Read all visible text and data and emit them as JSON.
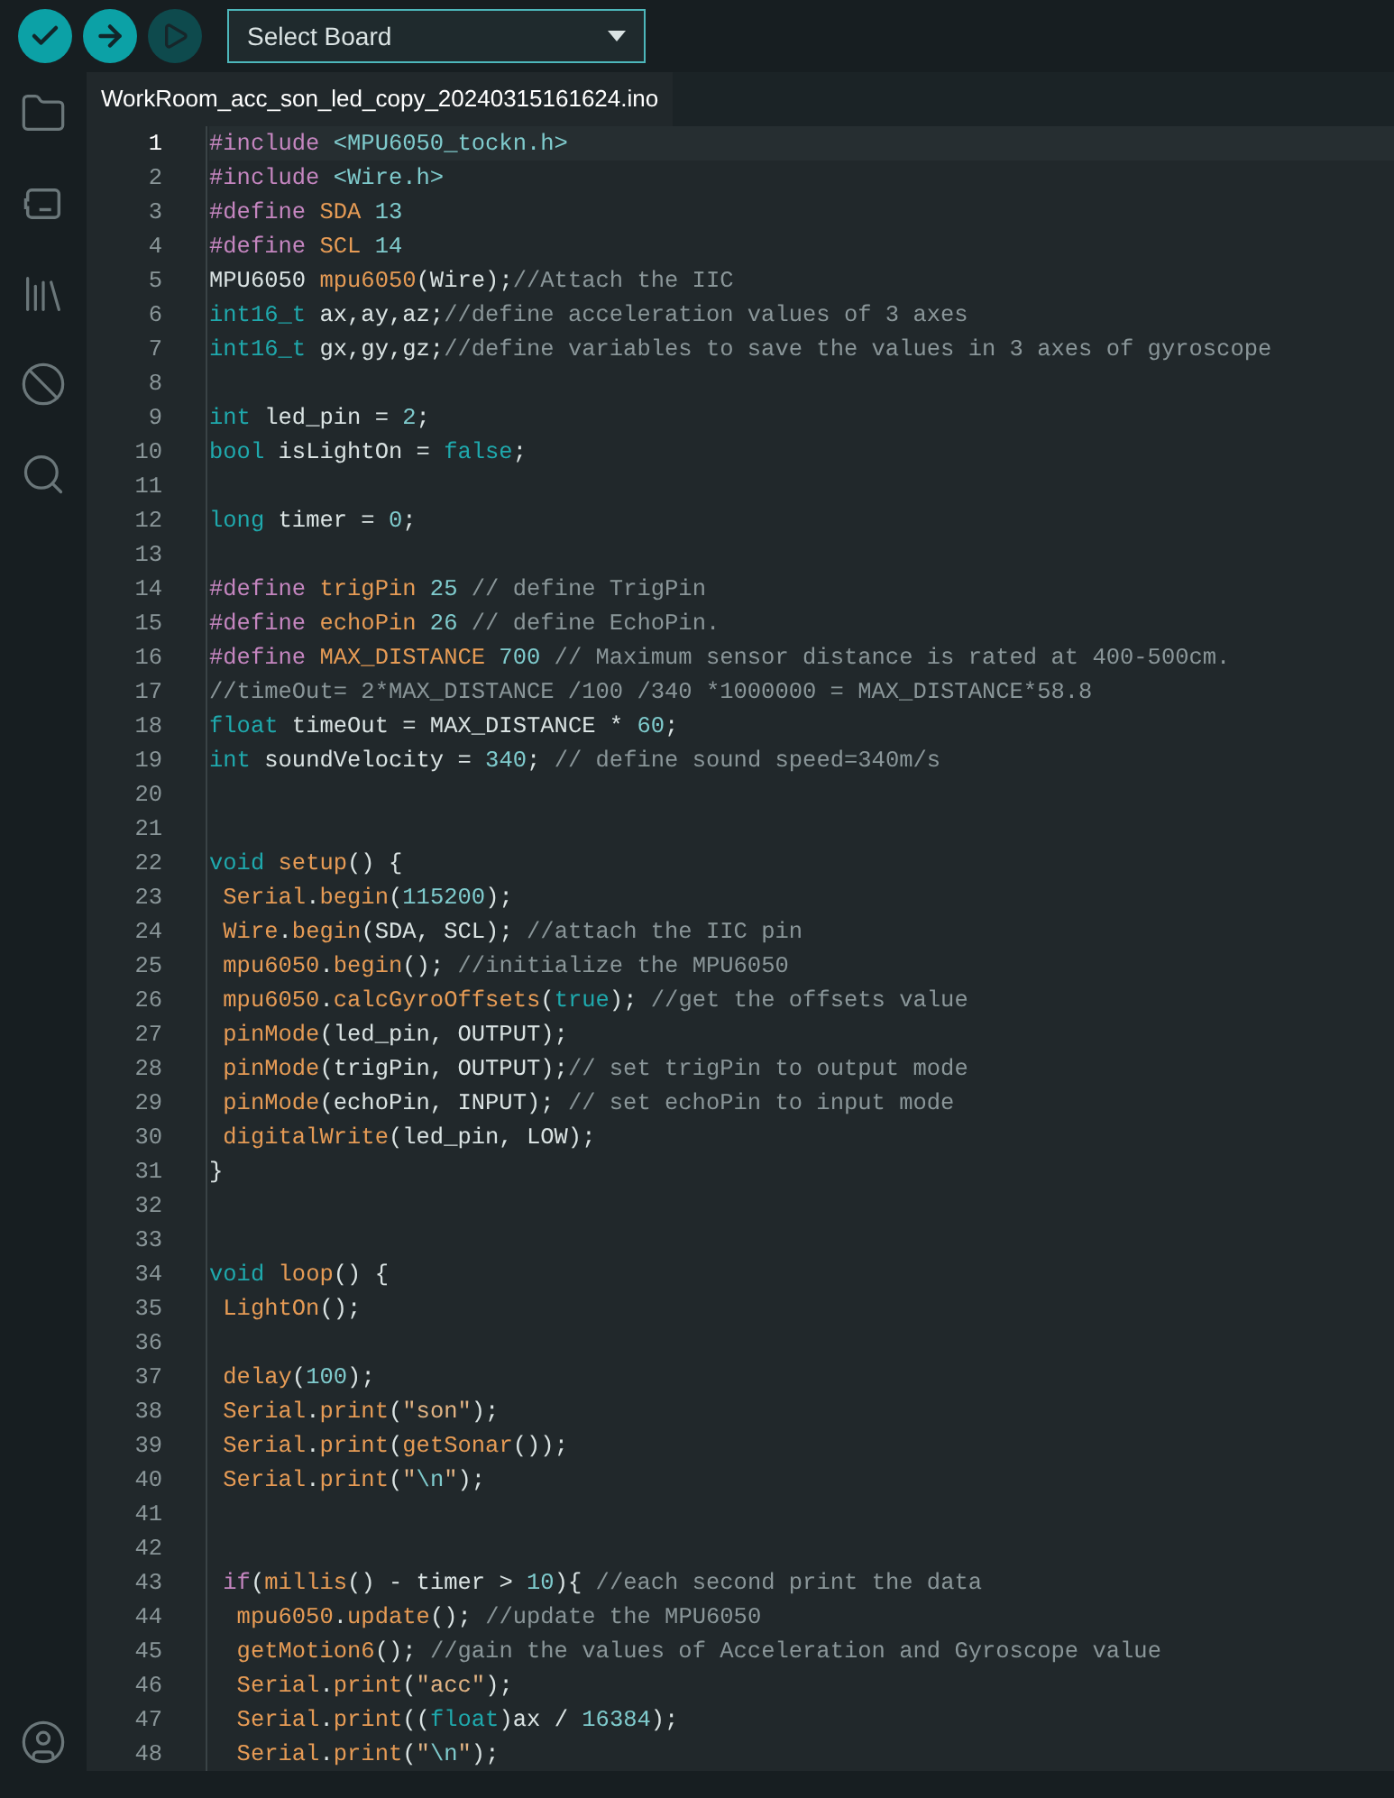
{
  "toolbar": {
    "buttons": [
      {
        "kind": "verify",
        "disabled": false
      },
      {
        "kind": "upload",
        "disabled": false
      },
      {
        "kind": "debug",
        "disabled": true
      }
    ],
    "board_select": {
      "value": "Select Board"
    }
  },
  "sidebar": {
    "items": [
      {
        "kind": "folder"
      },
      {
        "kind": "board"
      },
      {
        "kind": "library"
      },
      {
        "kind": "debug"
      },
      {
        "kind": "search"
      }
    ],
    "bottom_items": [
      {
        "kind": "account"
      }
    ]
  },
  "tabs": [
    {
      "label": "WorkRoom_acc_son_led_copy_20240315161624.ino",
      "selected": true
    }
  ],
  "editor": {
    "lines": [
      {
        "number": "1",
        "current": true,
        "tokens": [
          {
            "kind": "directive",
            "text": "#include"
          },
          {
            "kind": "number",
            "text": " <MPU6050_tockn.h>"
          }
        ]
      },
      {
        "number": "2",
        "current": false,
        "tokens": [
          {
            "kind": "directive",
            "text": "#include"
          },
          {
            "kind": "number",
            "text": " <Wire.h>"
          }
        ]
      },
      {
        "number": "3",
        "current": false,
        "tokens": [
          {
            "kind": "directive",
            "text": "#define"
          },
          {
            "kind": "function",
            "text": " SDA"
          },
          {
            "kind": "number",
            "text": " 13"
          }
        ]
      },
      {
        "number": "4",
        "current": false,
        "tokens": [
          {
            "kind": "directive",
            "text": "#define"
          },
          {
            "kind": "function",
            "text": " SCL"
          },
          {
            "kind": "number",
            "text": " 14"
          }
        ]
      },
      {
        "number": "5",
        "current": false,
        "tokens": [
          {
            "kind": "plain",
            "text": "MPU6050 "
          },
          {
            "kind": "function",
            "text": "mpu6050"
          },
          {
            "kind": "plain",
            "text": "(Wire);"
          },
          {
            "kind": "comment",
            "text": "//Attach the IIC"
          }
        ]
      },
      {
        "number": "6",
        "current": false,
        "tokens": [
          {
            "kind": "type",
            "text": "int16_t"
          },
          {
            "kind": "plain",
            "text": " ax,ay,az;"
          },
          {
            "kind": "comment",
            "text": "//define acceleration values of 3 axes"
          }
        ]
      },
      {
        "number": "7",
        "current": false,
        "tokens": [
          {
            "kind": "type",
            "text": "int16_t"
          },
          {
            "kind": "plain",
            "text": " gx,gy,gz;"
          },
          {
            "kind": "comment",
            "text": "//define variables to save the values in 3 axes of gyroscope"
          }
        ]
      },
      {
        "number": "8",
        "current": false
      },
      {
        "number": "9",
        "current": false,
        "tokens": [
          {
            "kind": "type",
            "text": "int"
          },
          {
            "kind": "plain",
            "text": " led_pin = "
          },
          {
            "kind": "number",
            "text": "2"
          },
          {
            "kind": "plain",
            "text": ";"
          }
        ]
      },
      {
        "number": "10",
        "current": false,
        "tokens": [
          {
            "kind": "type",
            "text": "bool"
          },
          {
            "kind": "plain",
            "text": " isLightOn = "
          },
          {
            "kind": "type",
            "text": "false"
          },
          {
            "kind": "plain",
            "text": ";"
          }
        ]
      },
      {
        "number": "11",
        "current": false
      },
      {
        "number": "12",
        "current": false,
        "tokens": [
          {
            "kind": "type",
            "text": "long"
          },
          {
            "kind": "plain",
            "text": " timer = "
          },
          {
            "kind": "number",
            "text": "0"
          },
          {
            "kind": "plain",
            "text": ";"
          }
        ]
      },
      {
        "number": "13",
        "current": false
      },
      {
        "number": "14",
        "current": false,
        "tokens": [
          {
            "kind": "directive",
            "text": "#define"
          },
          {
            "kind": "function",
            "text": " trigPin"
          },
          {
            "kind": "number",
            "text": " 25"
          },
          {
            "kind": "comment",
            "text": " // define TrigPin"
          }
        ]
      },
      {
        "number": "15",
        "current": false,
        "tokens": [
          {
            "kind": "directive",
            "text": "#define"
          },
          {
            "kind": "function",
            "text": " echoPin"
          },
          {
            "kind": "number",
            "text": " 26"
          },
          {
            "kind": "comment",
            "text": " // define EchoPin."
          }
        ]
      },
      {
        "number": "16",
        "current": false,
        "tokens": [
          {
            "kind": "directive",
            "text": "#define"
          },
          {
            "kind": "function",
            "text": " MAX_DISTANCE"
          },
          {
            "kind": "number",
            "text": " 700"
          },
          {
            "kind": "comment",
            "text": " // Maximum sensor distance is rated at 400-500cm."
          }
        ]
      },
      {
        "number": "17",
        "current": false,
        "tokens": [
          {
            "kind": "comment",
            "text": "//timeOut= 2*MAX_DISTANCE /100 /340 *1000000 = MAX_DISTANCE*58.8"
          }
        ]
      },
      {
        "number": "18",
        "current": false,
        "tokens": [
          {
            "kind": "type",
            "text": "float"
          },
          {
            "kind": "plain",
            "text": " timeOut = MAX_DISTANCE * "
          },
          {
            "kind": "number",
            "text": "60"
          },
          {
            "kind": "plain",
            "text": ";"
          }
        ]
      },
      {
        "number": "19",
        "current": false,
        "tokens": [
          {
            "kind": "type",
            "text": "int"
          },
          {
            "kind": "plain",
            "text": " soundVelocity = "
          },
          {
            "kind": "number",
            "text": "340"
          },
          {
            "kind": "plain",
            "text": ";"
          },
          {
            "kind": "comment",
            "text": " // define sound speed=340m/s"
          }
        ]
      },
      {
        "number": "20",
        "current": false
      },
      {
        "number": "21",
        "current": false
      },
      {
        "number": "22",
        "current": false,
        "tokens": [
          {
            "kind": "type",
            "text": "void"
          },
          {
            "kind": "function",
            "text": " setup"
          },
          {
            "kind": "plain",
            "text": "() {"
          }
        ]
      },
      {
        "number": "23",
        "current": false,
        "tokens": [
          {
            "kind": "function",
            "text": " Serial"
          },
          {
            "kind": "plain",
            "text": "."
          },
          {
            "kind": "function",
            "text": "begin"
          },
          {
            "kind": "plain",
            "text": "("
          },
          {
            "kind": "number",
            "text": "115200"
          },
          {
            "kind": "plain",
            "text": ");"
          }
        ]
      },
      {
        "number": "24",
        "current": false,
        "tokens": [
          {
            "kind": "function",
            "text": " Wire"
          },
          {
            "kind": "plain",
            "text": "."
          },
          {
            "kind": "function",
            "text": "begin"
          },
          {
            "kind": "plain",
            "text": "(SDA, SCL);"
          },
          {
            "kind": "comment",
            "text": " //attach the IIC pin"
          }
        ]
      },
      {
        "number": "25",
        "current": false,
        "tokens": [
          {
            "kind": "function",
            "text": " mpu6050"
          },
          {
            "kind": "plain",
            "text": "."
          },
          {
            "kind": "function",
            "text": "begin"
          },
          {
            "kind": "plain",
            "text": "();"
          },
          {
            "kind": "comment",
            "text": " //initialize the MPU6050"
          }
        ]
      },
      {
        "number": "26",
        "current": false,
        "tokens": [
          {
            "kind": "function",
            "text": " mpu6050"
          },
          {
            "kind": "plain",
            "text": "."
          },
          {
            "kind": "function",
            "text": "calcGyroOffsets"
          },
          {
            "kind": "plain",
            "text": "("
          },
          {
            "kind": "type",
            "text": "true"
          },
          {
            "kind": "plain",
            "text": ");"
          },
          {
            "kind": "comment",
            "text": " //get the offsets value"
          }
        ]
      },
      {
        "number": "27",
        "current": false,
        "tokens": [
          {
            "kind": "function",
            "text": " pinMode"
          },
          {
            "kind": "plain",
            "text": "(led_pin, OUTPUT);"
          }
        ]
      },
      {
        "number": "28",
        "current": false,
        "tokens": [
          {
            "kind": "function",
            "text": " pinMode"
          },
          {
            "kind": "plain",
            "text": "(trigPin, OUTPUT);"
          },
          {
            "kind": "comment",
            "text": "// set trigPin to output mode"
          }
        ]
      },
      {
        "number": "29",
        "current": false,
        "tokens": [
          {
            "kind": "function",
            "text": " pinMode"
          },
          {
            "kind": "plain",
            "text": "(echoPin, INPUT);"
          },
          {
            "kind": "comment",
            "text": " // set echoPin to input mode"
          }
        ]
      },
      {
        "number": "30",
        "current": false,
        "tokens": [
          {
            "kind": "function",
            "text": " digitalWrite"
          },
          {
            "kind": "plain",
            "text": "(led_pin, LOW);"
          }
        ]
      },
      {
        "number": "31",
        "current": false,
        "tokens": [
          {
            "kind": "plain",
            "text": "}"
          }
        ]
      },
      {
        "number": "32",
        "current": false
      },
      {
        "number": "33",
        "current": false
      },
      {
        "number": "34",
        "current": false,
        "tokens": [
          {
            "kind": "type",
            "text": "void"
          },
          {
            "kind": "function",
            "text": " loop"
          },
          {
            "kind": "plain",
            "text": "() {"
          }
        ]
      },
      {
        "number": "35",
        "current": false,
        "tokens": [
          {
            "kind": "function",
            "text": " LightOn"
          },
          {
            "kind": "plain",
            "text": "();"
          }
        ]
      },
      {
        "number": "36",
        "current": false
      },
      {
        "number": "37",
        "current": false,
        "tokens": [
          {
            "kind": "function",
            "text": " delay"
          },
          {
            "kind": "plain",
            "text": "("
          },
          {
            "kind": "number",
            "text": "100"
          },
          {
            "kind": "plain",
            "text": ");"
          }
        ]
      },
      {
        "number": "38",
        "current": false,
        "tokens": [
          {
            "kind": "function",
            "text": " Serial"
          },
          {
            "kind": "plain",
            "text": "."
          },
          {
            "kind": "function",
            "text": "print"
          },
          {
            "kind": "plain",
            "text": "("
          },
          {
            "kind": "string",
            "text": "\"son\""
          },
          {
            "kind": "plain",
            "text": ");"
          }
        ]
      },
      {
        "number": "39",
        "current": false,
        "tokens": [
          {
            "kind": "function",
            "text": " Serial"
          },
          {
            "kind": "plain",
            "text": "."
          },
          {
            "kind": "function",
            "text": "print"
          },
          {
            "kind": "plain",
            "text": "("
          },
          {
            "kind": "function",
            "text": "getSonar"
          },
          {
            "kind": "plain",
            "text": "());"
          }
        ]
      },
      {
        "number": "40",
        "current": false,
        "tokens": [
          {
            "kind": "function",
            "text": " Serial"
          },
          {
            "kind": "plain",
            "text": "."
          },
          {
            "kind": "function",
            "text": "print"
          },
          {
            "kind": "plain",
            "text": "("
          },
          {
            "kind": "string",
            "text": "\""
          },
          {
            "kind": "number",
            "text": "\\n"
          },
          {
            "kind": "string",
            "text": "\""
          },
          {
            "kind": "plain",
            "text": ");"
          }
        ]
      },
      {
        "number": "41",
        "current": false
      },
      {
        "number": "42",
        "current": false
      },
      {
        "number": "43",
        "current": false,
        "tokens": [
          {
            "kind": "directive",
            "text": " if"
          },
          {
            "kind": "plain",
            "text": "("
          },
          {
            "kind": "function",
            "text": "millis"
          },
          {
            "kind": "plain",
            "text": "() - timer > "
          },
          {
            "kind": "number",
            "text": "10"
          },
          {
            "kind": "plain",
            "text": "){"
          },
          {
            "kind": "comment",
            "text": " //each second print the data"
          }
        ]
      },
      {
        "number": "44",
        "current": false,
        "tokens": [
          {
            "kind": "function",
            "text": "  mpu6050"
          },
          {
            "kind": "plain",
            "text": "."
          },
          {
            "kind": "function",
            "text": "update"
          },
          {
            "kind": "plain",
            "text": "();"
          },
          {
            "kind": "comment",
            "text": " //update the MPU6050"
          }
        ]
      },
      {
        "number": "45",
        "current": false,
        "tokens": [
          {
            "kind": "function",
            "text": "  getMotion6"
          },
          {
            "kind": "plain",
            "text": "();"
          },
          {
            "kind": "comment",
            "text": " //gain the values of Acceleration and Gyroscope value"
          }
        ]
      },
      {
        "number": "46",
        "current": false,
        "tokens": [
          {
            "kind": "function",
            "text": "  Serial"
          },
          {
            "kind": "plain",
            "text": "."
          },
          {
            "kind": "function",
            "text": "print"
          },
          {
            "kind": "plain",
            "text": "("
          },
          {
            "kind": "string",
            "text": "\"acc\""
          },
          {
            "kind": "plain",
            "text": ");"
          }
        ]
      },
      {
        "number": "47",
        "current": false,
        "tokens": [
          {
            "kind": "function",
            "text": "  Serial"
          },
          {
            "kind": "plain",
            "text": "."
          },
          {
            "kind": "function",
            "text": "print"
          },
          {
            "kind": "plain",
            "text": "(("
          },
          {
            "kind": "type",
            "text": "float"
          },
          {
            "kind": "plain",
            "text": ")ax / "
          },
          {
            "kind": "number",
            "text": "16384"
          },
          {
            "kind": "plain",
            "text": ");"
          }
        ]
      },
      {
        "number": "48",
        "current": false,
        "tokens": [
          {
            "kind": "function",
            "text": "  Serial"
          },
          {
            "kind": "plain",
            "text": "."
          },
          {
            "kind": "function",
            "text": "print"
          },
          {
            "kind": "plain",
            "text": "("
          },
          {
            "kind": "string",
            "text": "\""
          },
          {
            "kind": "number",
            "text": "\\n"
          },
          {
            "kind": "string",
            "text": "\""
          },
          {
            "kind": "plain",
            "text": ");"
          }
        ]
      }
    ]
  }
}
